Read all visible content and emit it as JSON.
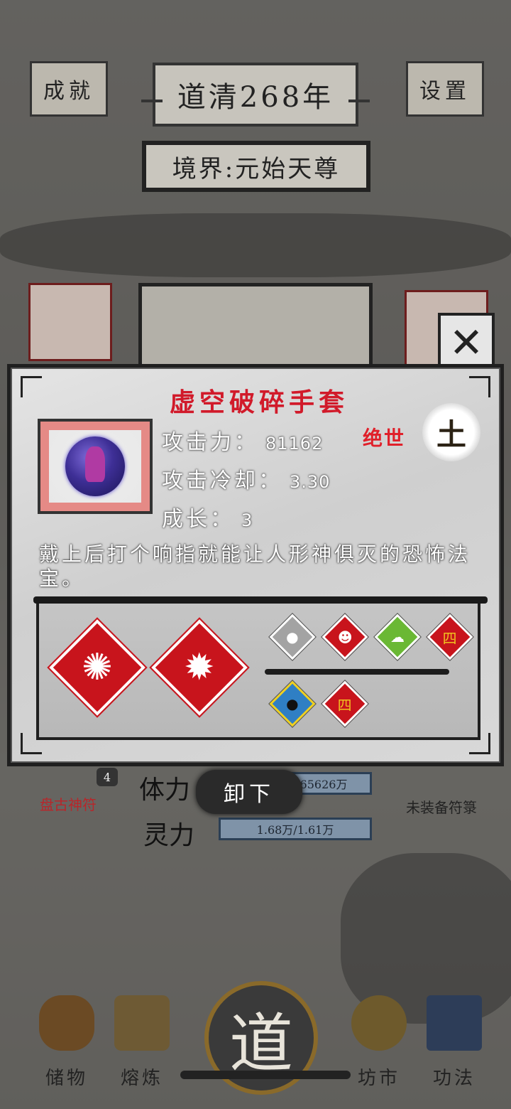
{
  "header": {
    "achievements_label": "成就",
    "year_label": "道清268年",
    "settings_label": "设置",
    "realm_label": "境界:元始天尊"
  },
  "status": {
    "stamina_label": "体力",
    "stamina_value": "65626万",
    "spirit_label": "灵力",
    "spirit_value": "1.68万/1.61万",
    "left_slot_caption": "盘古神符",
    "left_slot_badge": "4",
    "right_slot_caption": "未装备符箓"
  },
  "item": {
    "name": "虚空破碎手套",
    "attack_label": "攻击力：",
    "attack_value": "81162",
    "cooldown_label": "攻击冷却：",
    "cooldown_value": "3.30",
    "growth_label": "成长：",
    "growth_value": "3",
    "rarity": "绝世",
    "element": "土",
    "description": "戴上后打个响指就能让人形神俱灭的恐怖法宝。",
    "icon": "void-gauntlet-icon",
    "effects": [
      {
        "icon": "shatter-burst-icon",
        "color": "#c8141c"
      },
      {
        "icon": "explosion-burst-icon",
        "color": "#c8141c"
      }
    ],
    "buffs": [
      {
        "icon": "bomb-icon",
        "color": "#9a9a9a"
      },
      {
        "icon": "bleeding-face-icon",
        "color": "#c8141c"
      },
      {
        "icon": "poison-cloud-icon",
        "color": "#6ab834"
      },
      {
        "icon": "power-four-icon",
        "color": "#c8141c"
      },
      {
        "icon": "freeze-stun-icon",
        "color": "#2f7fc4"
      },
      {
        "icon": "power-four-stars-icon",
        "color": "#c8141c"
      }
    ]
  },
  "actions": {
    "unequip_label": "卸下",
    "close_icon": "close-icon"
  },
  "nav": {
    "storage": "储物",
    "refine": "熔炼",
    "dao": "道",
    "market": "坊市",
    "skills": "功法"
  }
}
